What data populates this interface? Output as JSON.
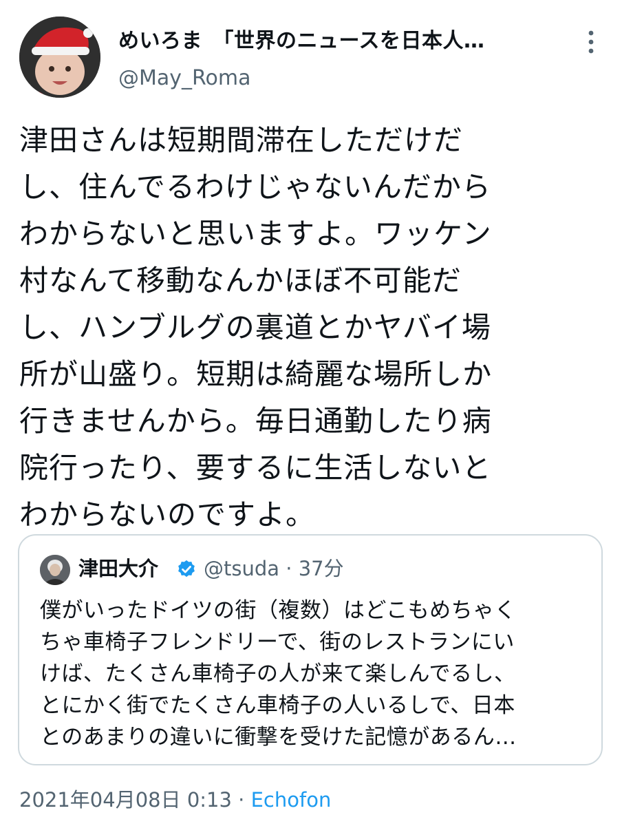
{
  "author": {
    "display_name": "めいろま　「世界のニュースを日本人…",
    "handle": "@May_Roma"
  },
  "tweet": {
    "text_lines": [
      "津田さんは短期間滞在しただけだ",
      "し、住んでるわけじゃないんだから",
      "わからないと思いますよ。ワッケン",
      "村なんて移動なんかほぼ不可能だ",
      "し、ハンブルグの裏道とかヤバイ場",
      "所が山盛り。短期は綺麗な場所しか",
      "行きませんから。毎日通勤したり病",
      "院行ったり、要するに生活しないと",
      "わからないのですよ。"
    ]
  },
  "quoted_tweet": {
    "display_name": "津田大介",
    "handle": "@tsuda",
    "separator": "·",
    "time": "37分",
    "text_lines": [
      "僕がいったドイツの街（複数）はどこもめちゃく",
      "ちゃ車椅子フレンドリーで、街のレストランにい",
      "けば、たくさん車椅子の人が来て楽しんでるし、",
      "とにかく街でたくさん車椅子の人いるしで、日本",
      "とのあまりの違いに衝撃を受けた記憶があるん…"
    ]
  },
  "footer": {
    "timestamp": "2021年04月08日 0:13",
    "separator": "·",
    "source": "Echofon"
  },
  "icons": {
    "more": "more-vertical-icon",
    "verified": "verified-badge-icon"
  },
  "colors": {
    "text": "#0f1419",
    "secondary": "#536471",
    "link": "#1d9bf0",
    "border": "#cfd9de"
  }
}
